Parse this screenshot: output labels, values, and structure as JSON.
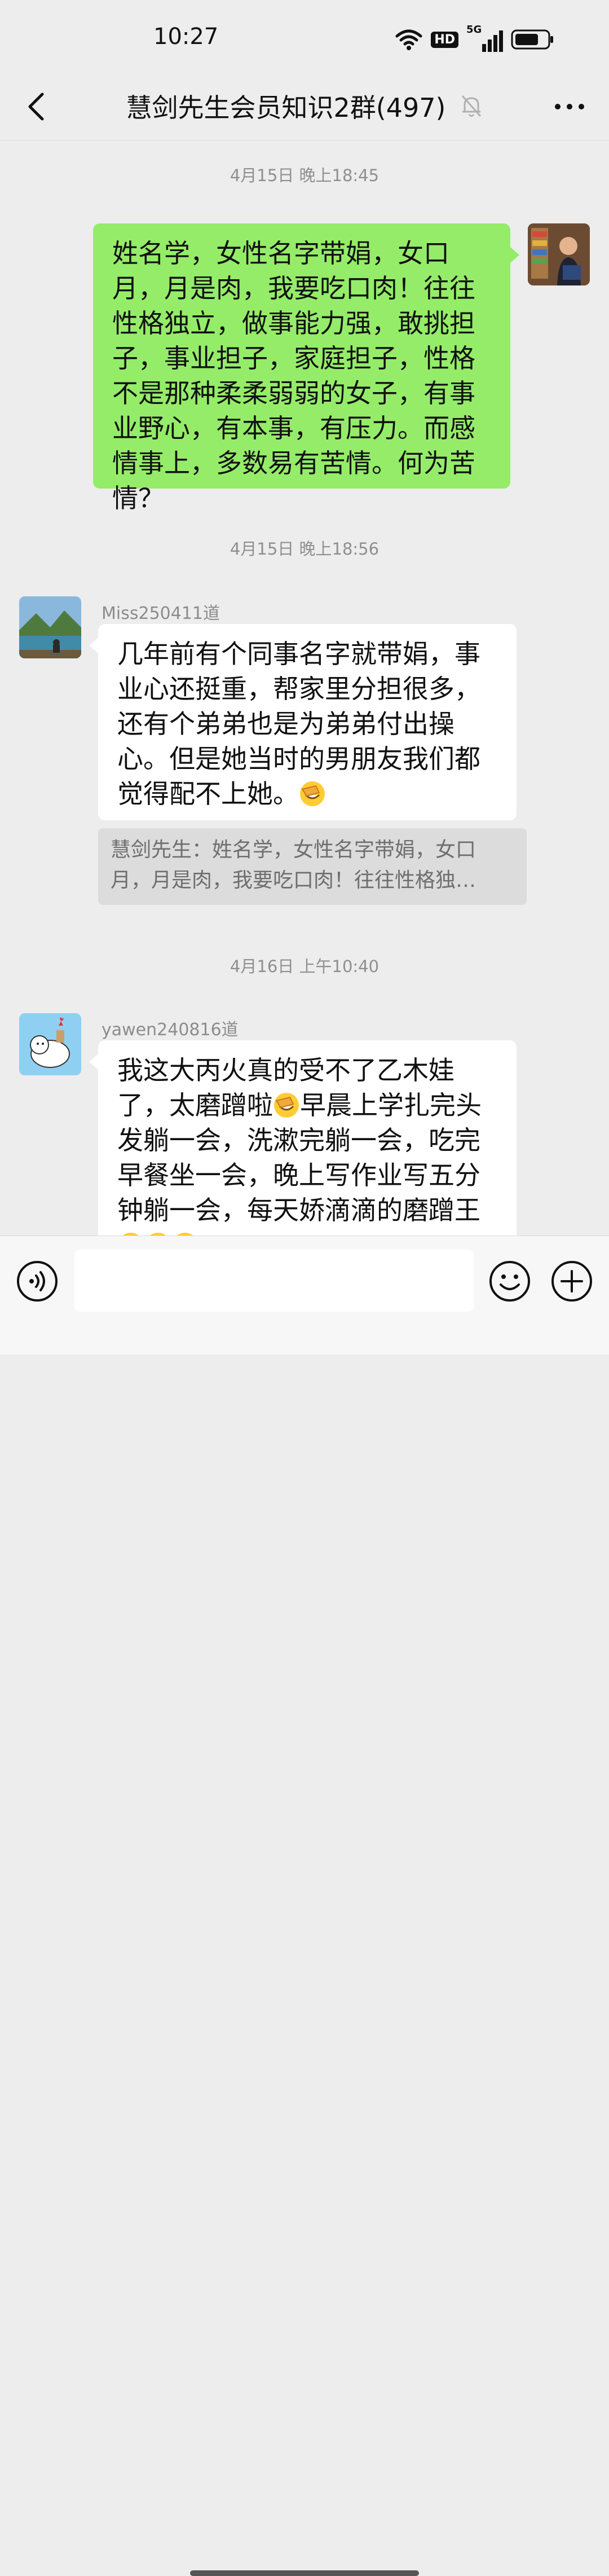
{
  "status_bar": {
    "time": "10:27",
    "hd_label": "HD",
    "network_label": "5G",
    "icons": [
      "wifi-icon",
      "hd-icon",
      "signal-5g-icon",
      "battery-icon"
    ]
  },
  "header": {
    "title": "慧剑先生会员知识2群(497)",
    "icons": [
      "back-chevron-icon",
      "muted-bell-icon",
      "more-dots-icon"
    ]
  },
  "messages": [
    {
      "type": "timestamp",
      "text": "4月15日 晚上18:45"
    },
    {
      "type": "sent",
      "text": "姓名学，女性名字带娟，女口月，月是肉，我要吃口肉！往往性格独立，做事能力强，敢挑担子，事业担子，家庭担子，性格不是那种柔柔弱弱的女子，有事业野心，有本事，有压力。而感情事上，多数易有苦情。何为苦情？"
    },
    {
      "type": "timestamp",
      "text": "4月15日 晚上18:56"
    },
    {
      "type": "received",
      "sender": "Miss250411道",
      "text": "几年前有个同事名字就带娟，事业心还挺重，帮家里分担很多，还有个弟弟也是为弟弟付出操心。但是她当时的男朋友我们都觉得配不上她。",
      "emoji": "facepalm-emoji",
      "quote": "慧剑先生：姓名学，女性名字带娟，女口月，月是肉，我要吃口肉！往往性格独…"
    },
    {
      "type": "timestamp",
      "text": "4月16日 上午10:40"
    },
    {
      "type": "received",
      "sender": "yawen240816道",
      "text_part1": "我这大丙火真的受不了乙木娃了，太磨蹭啦",
      "text_part2": "早晨上学扎完头发躺一会，洗漱完躺一会，吃完早餐坐一会，晚上写作业写五分钟躺一会，每天娇滴滴的磨蹭王",
      "emojis": [
        "facepalm-emoji",
        "teary-emoji",
        "teary-emoji",
        "teary-emoji"
      ]
    }
  ],
  "input_bar": {
    "placeholder": "",
    "icons": [
      "voice-icon",
      "emoji-smile-icon",
      "plus-circle-icon"
    ]
  },
  "colors": {
    "background": "#ededed",
    "sent_bubble": "#95ec69",
    "received_bubble": "#ffffff",
    "quote_bg": "#dcdcdc"
  }
}
